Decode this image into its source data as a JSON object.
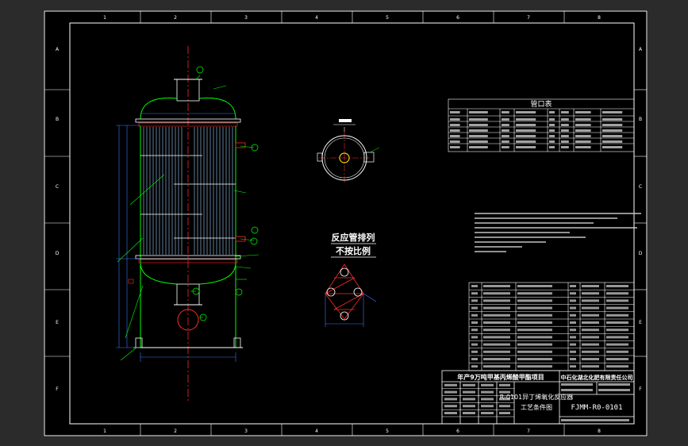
{
  "colors": {
    "background": "#2b2b2b",
    "sheet": "#000000",
    "frame": "#ffffff",
    "vessel": "#00ff00",
    "tubes": "#9fd0ff",
    "centerline": "#ff2a2a",
    "annotation": "#00ff00",
    "dimension": "#3a7bff",
    "pipe": "#ff2a2a",
    "text": "#ffffff"
  },
  "border": {
    "zone_numbers_top": [
      "1",
      "2",
      "3",
      "4",
      "5",
      "6",
      "7",
      "8"
    ],
    "zone_numbers_bottom": [
      "1",
      "2",
      "3",
      "4",
      "5",
      "6",
      "7",
      "8"
    ],
    "zone_letters": [
      "A",
      "B",
      "C",
      "D",
      "E",
      "F"
    ]
  },
  "nozzle_table": {
    "title": "管口表"
  },
  "reactor_arrangement": {
    "title": "反应管排列",
    "subtitle": "不按比例"
  },
  "title_block": {
    "project": "年产9万吨甲基丙烯酸甲酯项目",
    "company": "中石化湖北化肥有限责任公司",
    "drawing_title_line1": "R-0101异丁烯氧化反应器",
    "drawing_title_line2": "工艺条件图",
    "drawing_number": "FJMM-R0-0101"
  }
}
